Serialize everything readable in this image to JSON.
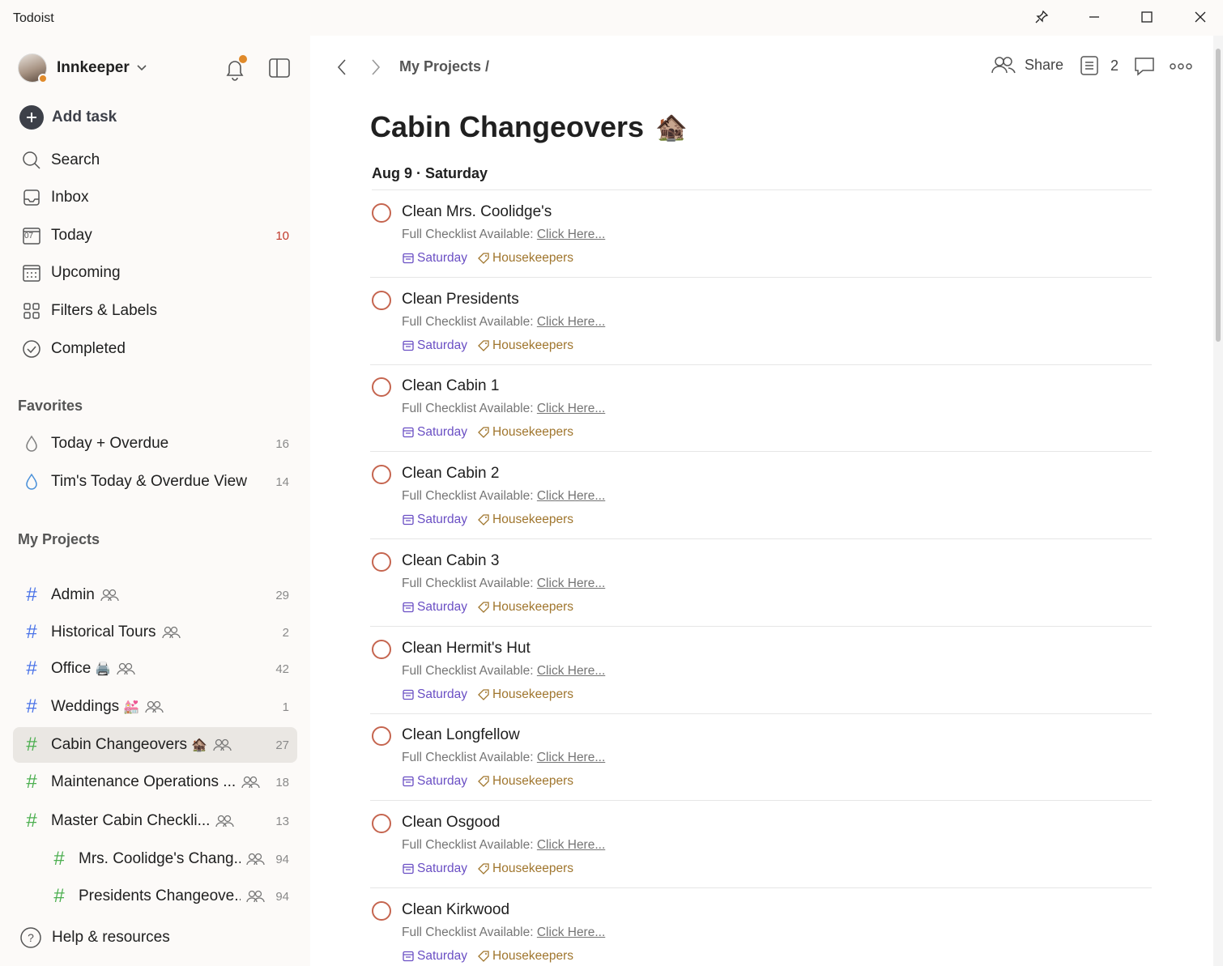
{
  "window": {
    "title": "Todoist"
  },
  "sidebar": {
    "user_name": "Innkeeper",
    "add_task": "Add task",
    "nav": [
      {
        "label": "Search",
        "icon": "search-icon"
      },
      {
        "label": "Inbox",
        "icon": "inbox-icon"
      },
      {
        "label": "Today",
        "icon": "calendar-today-icon",
        "count": "10",
        "icon_text": "07"
      },
      {
        "label": "Upcoming",
        "icon": "calendar-grid-icon"
      },
      {
        "label": "Filters & Labels",
        "icon": "grid-icon"
      },
      {
        "label": "Completed",
        "icon": "check-circle-icon"
      }
    ],
    "favorites_heading": "Favorites",
    "favorites": [
      {
        "label": "Today + Overdue",
        "count": "16",
        "icon": "drop-icon",
        "color": "#808080"
      },
      {
        "label": "Tim's Today & Overdue View",
        "count": "14",
        "icon": "drop-icon",
        "color": "#4a90d9"
      }
    ],
    "projects_heading": "My Projects",
    "projects": [
      {
        "label": "Admin",
        "emoji": "",
        "count": "29",
        "color": "#4a73e8",
        "shared": true
      },
      {
        "label": "Historical Tours",
        "emoji": "",
        "count": "2",
        "color": "#4a73e8",
        "shared": true
      },
      {
        "label": "Office",
        "emoji": "🖨️",
        "count": "42",
        "color": "#4a73e8",
        "shared": true
      },
      {
        "label": "Weddings",
        "emoji": "💒",
        "count": "1",
        "color": "#4a73e8",
        "shared": true
      },
      {
        "label": "Cabin Changeovers",
        "emoji": "🏚️",
        "count": "27",
        "color": "#4caf50",
        "shared": true,
        "active": true
      },
      {
        "label": "Maintenance Operations ...",
        "emoji": "",
        "count": "18",
        "color": "#4caf50",
        "shared": true
      },
      {
        "label": "Master Cabin Checkli...",
        "emoji": "",
        "count": "13",
        "color": "#4caf50",
        "shared": true
      },
      {
        "label": "Mrs. Coolidge's Chang...",
        "emoji": "",
        "count": "94",
        "color": "#4caf50",
        "shared": true,
        "sub": true
      },
      {
        "label": "Presidents Changeove...",
        "emoji": "",
        "count": "94",
        "color": "#4caf50",
        "shared": true,
        "sub": true
      }
    ],
    "help": "Help & resources"
  },
  "topbar": {
    "breadcrumb": "My Projects /",
    "share": "Share",
    "view_count": "2"
  },
  "main": {
    "title": "Cabin Changeovers",
    "title_emoji": "🏚️",
    "date_heading": "Aug 9 · Saturday",
    "tasks": [
      {
        "name": "Clean Mrs. Coolidge's",
        "desc_prefix": "Full Checklist Available: ",
        "desc_link": "Click Here...",
        "date": "Saturday",
        "label": "Housekeepers"
      },
      {
        "name": "Clean Presidents",
        "desc_prefix": "Full Checklist Available: ",
        "desc_link": "Click Here...",
        "date": "Saturday",
        "label": "Housekeepers"
      },
      {
        "name": "Clean Cabin 1",
        "desc_prefix": "Full Checklist Available: ",
        "desc_link": "Click Here...",
        "date": "Saturday",
        "label": "Housekeepers"
      },
      {
        "name": "Clean Cabin 2",
        "desc_prefix": "Full Checklist Available: ",
        "desc_link": "Click Here...",
        "date": "Saturday",
        "label": "Housekeepers"
      },
      {
        "name": "Clean Cabin 3",
        "desc_prefix": "Full Checklist Available: ",
        "desc_link": "Click Here...",
        "date": "Saturday",
        "label": "Housekeepers"
      },
      {
        "name": "Clean Hermit's Hut",
        "desc_prefix": "Full Checklist Available: ",
        "desc_link": "Click Here...",
        "date": "Saturday",
        "label": "Housekeepers"
      },
      {
        "name": "Clean Longfellow",
        "desc_prefix": "Full Checklist Available: ",
        "desc_link": "Click Here...",
        "date": "Saturday",
        "label": "Housekeepers"
      },
      {
        "name": "Clean Osgood",
        "desc_prefix": "Full Checklist Available: ",
        "desc_link": "Click Here...",
        "date": "Saturday",
        "label": "Housekeepers"
      },
      {
        "name": "Clean Kirkwood",
        "desc_prefix": "Full Checklist Available: ",
        "desc_link": "Click Here...",
        "date": "Saturday",
        "label": "Housekeepers"
      }
    ]
  },
  "colors": {
    "accent": "#c5654f",
    "date": "#6a4fc4",
    "label": "#a0762e",
    "notification": "#e08a2a"
  }
}
